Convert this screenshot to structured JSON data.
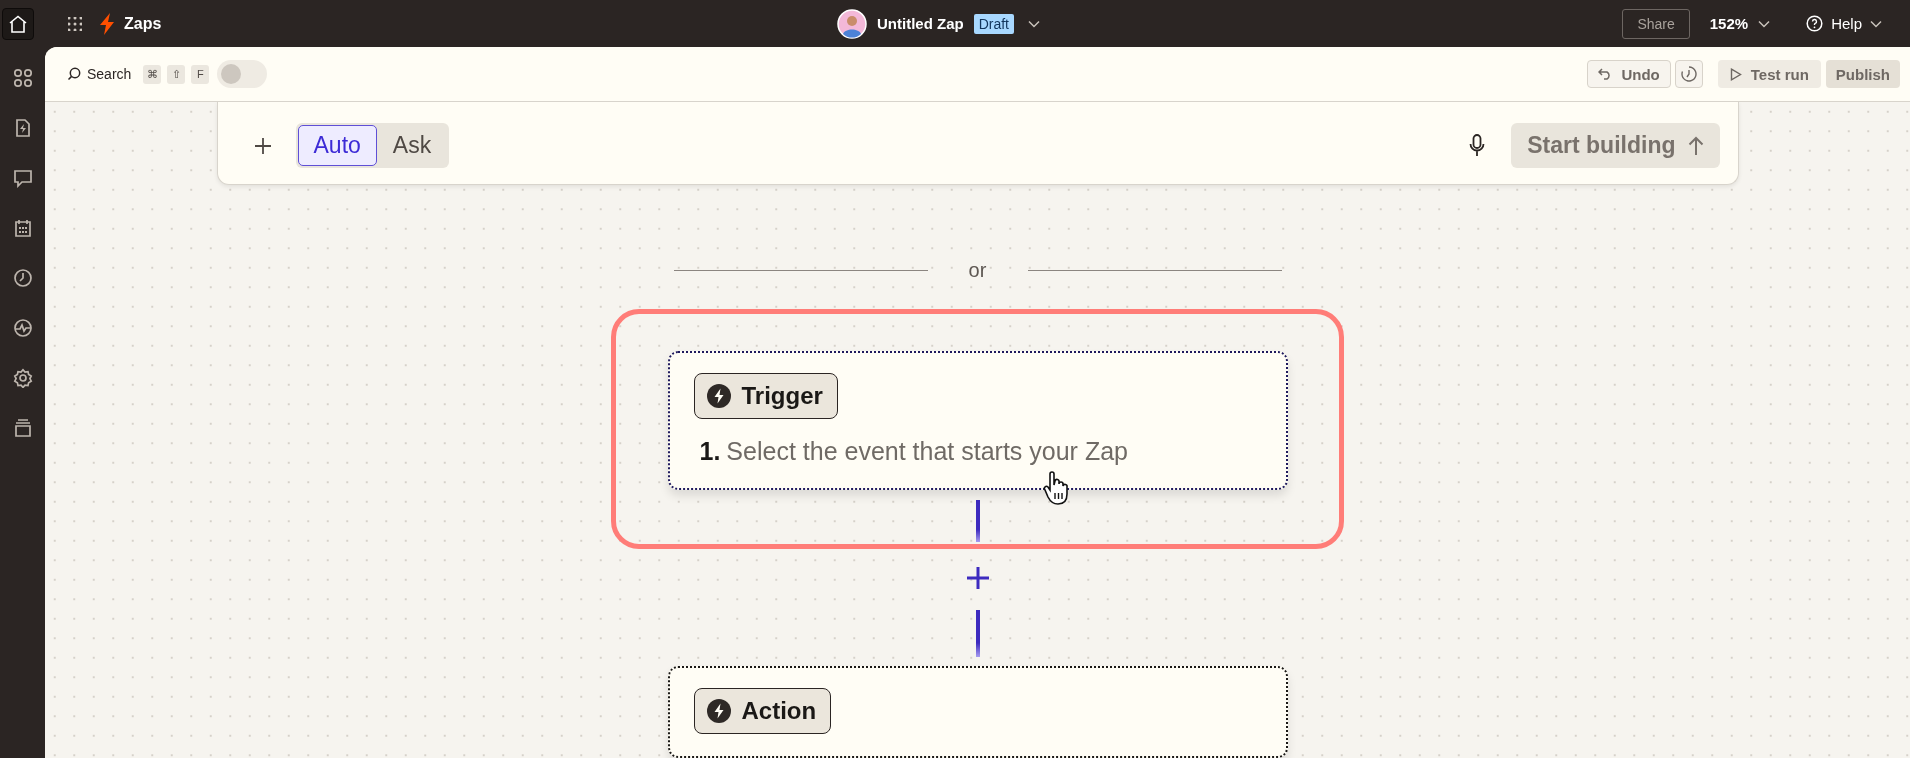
{
  "topbar": {
    "app_title": "Zaps",
    "zap_name": "Untitled Zap",
    "status_badge": "Draft",
    "share": "Share",
    "zoom": "152%",
    "help": "Help"
  },
  "toolbar": {
    "search": "Search",
    "shortcut_keys": [
      "⌘",
      "⇧",
      "F"
    ],
    "toggle": {
      "on": false
    },
    "undo": "Undo",
    "test_run": "Test run",
    "publish": "Publish"
  },
  "prompt": {
    "modes": [
      {
        "label": "Auto",
        "selected": true
      },
      {
        "label": "Ask",
        "selected": false
      }
    ],
    "submit": "Start building"
  },
  "divider_label": "or",
  "steps": [
    {
      "badge": "Trigger",
      "number": "1.",
      "text": "Select the event that starts your Zap",
      "highlighted": true
    },
    {
      "badge": "Action",
      "highlighted": false
    }
  ]
}
